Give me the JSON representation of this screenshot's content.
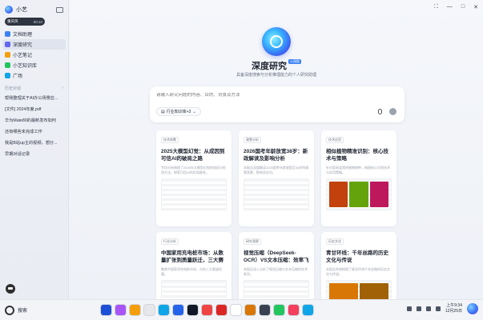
{
  "sidebar": {
    "title": "小艺",
    "user_pill": {
      "name": "重庆风",
      "status": "00:10"
    },
    "nav": [
      {
        "label": "文档助理",
        "color": "#3b82f6"
      },
      {
        "label": "深度研究",
        "color": "#6366f1"
      },
      {
        "label": "小艺笔记",
        "color": "#f59e0b"
      },
      {
        "label": "小艺知识库",
        "color": "#22c55e"
      },
      {
        "label": "广场",
        "color": "#0ea5e9"
      }
    ],
    "history_label": "历史对话",
    "history": [
      "帮我整理关于AI办公场景应...",
      "[文件] 2024年度.pdf",
      "华为Mate80的最新发布如何",
      "还有哪些未完成工作",
      "我是B站up主的视频，想分...",
      "早期对话记录"
    ]
  },
  "main": {
    "title": "深度研究",
    "badge": "公测版",
    "subtitle": "具备深度搜索与分析推理能力的个人研究助理",
    "search_placeholder": "请输入研究问题的内容、目的、背景及方法",
    "knowledge_chip": "行业知识库+3",
    "cards": [
      {
        "tag": "技术前瞻",
        "title": "2025大模型幻觉：从成因到可信AI的破局之路",
        "desc": "专项分析梳理了2025年大模型幻觉的成因与检测方法，探索可信AI的实现路径。",
        "thumb": "doc"
      },
      {
        "tag": "政策分析",
        "title": "2026国考年龄放宽38岁：新政解读及影响分析",
        "desc": "本报告深度解读2026国考年龄放宽至38岁的政策背景、影响及应对。",
        "thumb": "doc"
      },
      {
        "tag": "技术应用",
        "title": "相似植物精准识别：核心技术与策略",
        "desc": "针对容易混淆的植物物种，梳理核心识别技术与实用策略。",
        "thumb": "img"
      },
      {
        "tag": "行业分析",
        "title": "中国家用充电桩市场：从数量扩张到质量跃迁，三大赛道...",
        "desc": "聚焦中国家用充电桩市场，分析三大赛道机遇。",
        "thumb": "chart"
      },
      {
        "tag": "研究观察",
        "title": "视觉压缩（DeepSeek-OCR）VS文本压缩：效率飞跃与精...",
        "desc": "本报告深入分析了视觉压缩与文本压缩的技术差异。",
        "thumb": "doc"
      },
      {
        "tag": "历史文化",
        "title": "青甘环线：千年丝路的历史文化与传说",
        "desc": "本报告系统梳理了青甘环线千年丝路的历史文化与传说。",
        "thumb": "img2"
      }
    ]
  },
  "taskbar": {
    "search_label": "搜索",
    "time": "上午9:34",
    "date": "12月25日",
    "apps": [
      "#1d4ed8",
      "#a855f7",
      "#f59e0b",
      "#e5e7eb",
      "#0ea5e9",
      "#2563eb",
      "#111827",
      "#ef4444",
      "#dc2626",
      "#ffffff",
      "#d97706",
      "#374151",
      "#22c55e",
      "#f43f5e",
      "#0ea5e9"
    ]
  },
  "window": {
    "controls": [
      "⛶",
      "—",
      "□",
      "✕"
    ]
  }
}
